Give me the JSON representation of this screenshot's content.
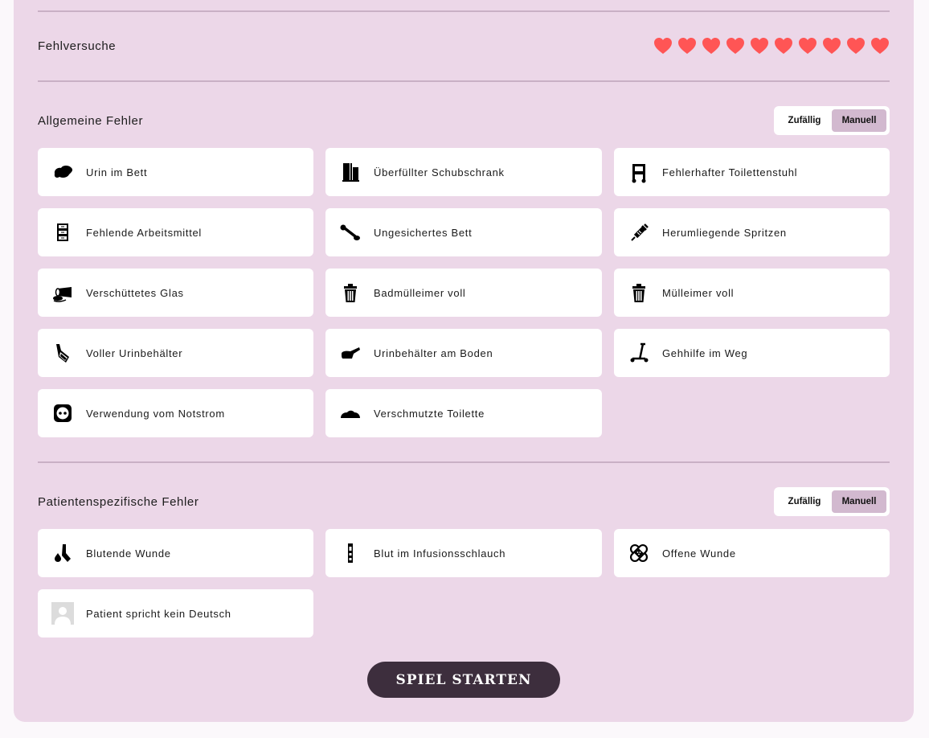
{
  "lives": {
    "label": "Fehlversuche",
    "count": 10,
    "color": "#ff5555"
  },
  "general": {
    "title": "Allgemeine Fehler",
    "toggle": {
      "random": "Zufällig",
      "manual": "Manuell",
      "selected": "manual"
    },
    "items": [
      {
        "label": "Urin im Bett",
        "icon": "urine-puddle-icon"
      },
      {
        "label": "Überfüllter Schubschrank",
        "icon": "cabinet-icon"
      },
      {
        "label": "Fehlerhafter Toilettenstuhl",
        "icon": "commode-chair-icon"
      },
      {
        "label": "Fehlende Arbeitsmittel",
        "icon": "drawer-unit-icon"
      },
      {
        "label": "Ungesichertes Bett",
        "icon": "bed-brake-icon"
      },
      {
        "label": "Herumliegende Spritzen",
        "icon": "syringe-icon"
      },
      {
        "label": "Verschüttetes Glas",
        "icon": "spilled-glass-icon"
      },
      {
        "label": "Badmülleimer voll",
        "icon": "trash-can-icon"
      },
      {
        "label": "Mülleimer voll",
        "icon": "trash-can-icon"
      },
      {
        "label": "Voller Urinbehälter",
        "icon": "urine-bottle-icon"
      },
      {
        "label": "Urinbehälter am Boden",
        "icon": "urinal-floor-icon"
      },
      {
        "label": "Gehhilfe im Weg",
        "icon": "walking-aid-icon"
      },
      {
        "label": "Verwendung vom Notstrom",
        "icon": "power-outlet-icon"
      },
      {
        "label": "Verschmutzte Toilette",
        "icon": "dirty-toilet-icon"
      }
    ]
  },
  "patient": {
    "title": "Patientenspezifische Fehler",
    "toggle": {
      "random": "Zufällig",
      "manual": "Manuell",
      "selected": "manual"
    },
    "items": [
      {
        "label": "Blutende Wunde",
        "icon": "bleeding-wound-icon"
      },
      {
        "label": "Blut im Infusionsschlauch",
        "icon": "iv-tube-icon"
      },
      {
        "label": "Offene Wunde",
        "icon": "bandage-icon"
      },
      {
        "label": "Patient spricht kein Deutsch",
        "icon": "person-avatar-icon"
      }
    ]
  },
  "start_button": "SPIEL STARTEN"
}
